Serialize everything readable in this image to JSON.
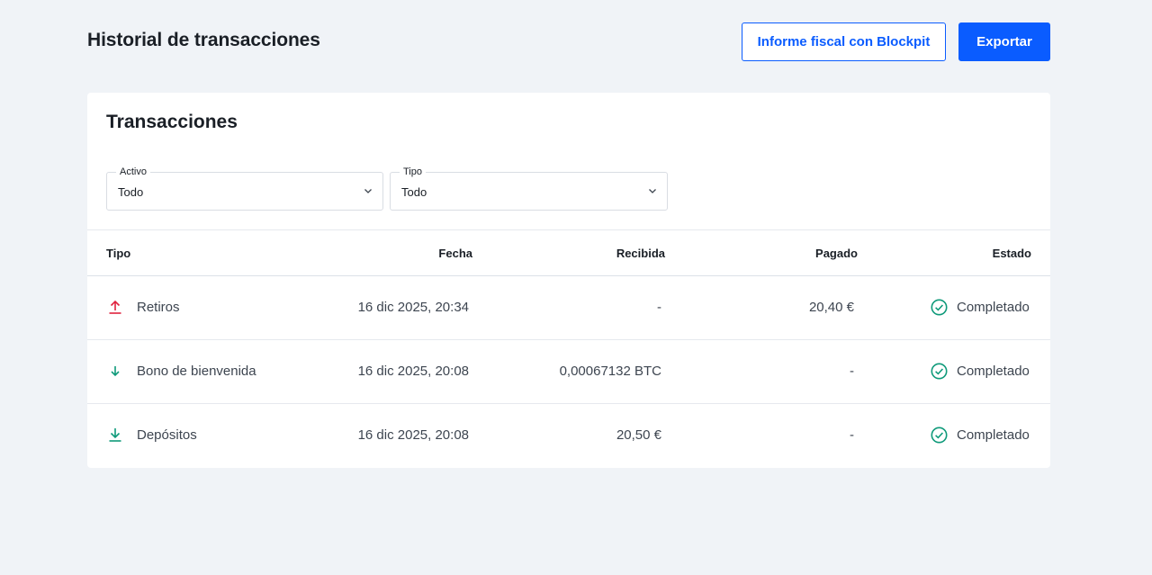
{
  "header": {
    "title": "Historial de transacciones",
    "fiscal_button": "Informe fiscal con Blockpit",
    "export_button": "Exportar"
  },
  "card": {
    "title": "Transacciones",
    "filters": [
      {
        "label": "Activo",
        "value": "Todo"
      },
      {
        "label": "Tipo",
        "value": "Todo"
      }
    ]
  },
  "table": {
    "columns": [
      "Tipo",
      "Fecha",
      "Recibida",
      "Pagado",
      "Estado"
    ],
    "rows": [
      {
        "icon": "withdraw-icon",
        "type": "Retiros",
        "date": "16 dic 2025, 20:34",
        "received": "-",
        "paid": "20,40 €",
        "status": "Completado"
      },
      {
        "icon": "bonus-arrow-down-icon",
        "type": "Bono de bienvenida",
        "date": "16 dic 2025, 20:08",
        "received": "0,00067132 BTC",
        "paid": "-",
        "status": "Completado"
      },
      {
        "icon": "deposit-icon",
        "type": "Depósitos",
        "date": "16 dic 2025, 20:08",
        "received": "20,50 €",
        "paid": "-",
        "status": "Completado"
      }
    ]
  },
  "colors": {
    "accent": "#0a5cff",
    "withdraw": "#e0223e",
    "success": "#0f9a7a",
    "background": "#f0f3f7"
  }
}
